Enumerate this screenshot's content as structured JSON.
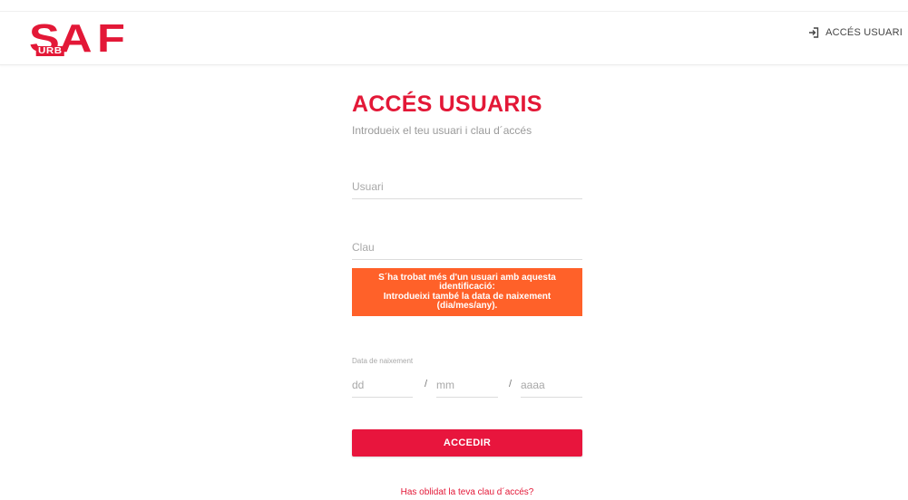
{
  "header": {
    "logo_text": "SAF",
    "logo_subtext": "URB",
    "login_link_label": "ACCÉS USUARI",
    "login_icon": "login-arrow-icon",
    "brand_color": "#e31837"
  },
  "login": {
    "title": "ACCÉS USUARIS",
    "subtitle": "Introdueix el teu usuari i clau d´accés",
    "user_placeholder": "Usuari",
    "user_value": "",
    "password_placeholder": "Clau",
    "password_value": "",
    "alert": {
      "line1": "S´ha trobat més d'un usuari amb aquesta",
      "line2": "identificació:",
      "line3": "Introdueixi també la data de naixement",
      "line4": "(dia/mes/any).",
      "color": "#ff6129"
    },
    "dob_label": "Data de naixement",
    "day_placeholder": "dd",
    "month_placeholder": "mm",
    "year_placeholder": "aaaa",
    "separator": "/",
    "submit_label": "ACCEDIR",
    "forgot_link": "Has oblidat la teva clau d´accés?",
    "button_color": "#e8153d"
  }
}
